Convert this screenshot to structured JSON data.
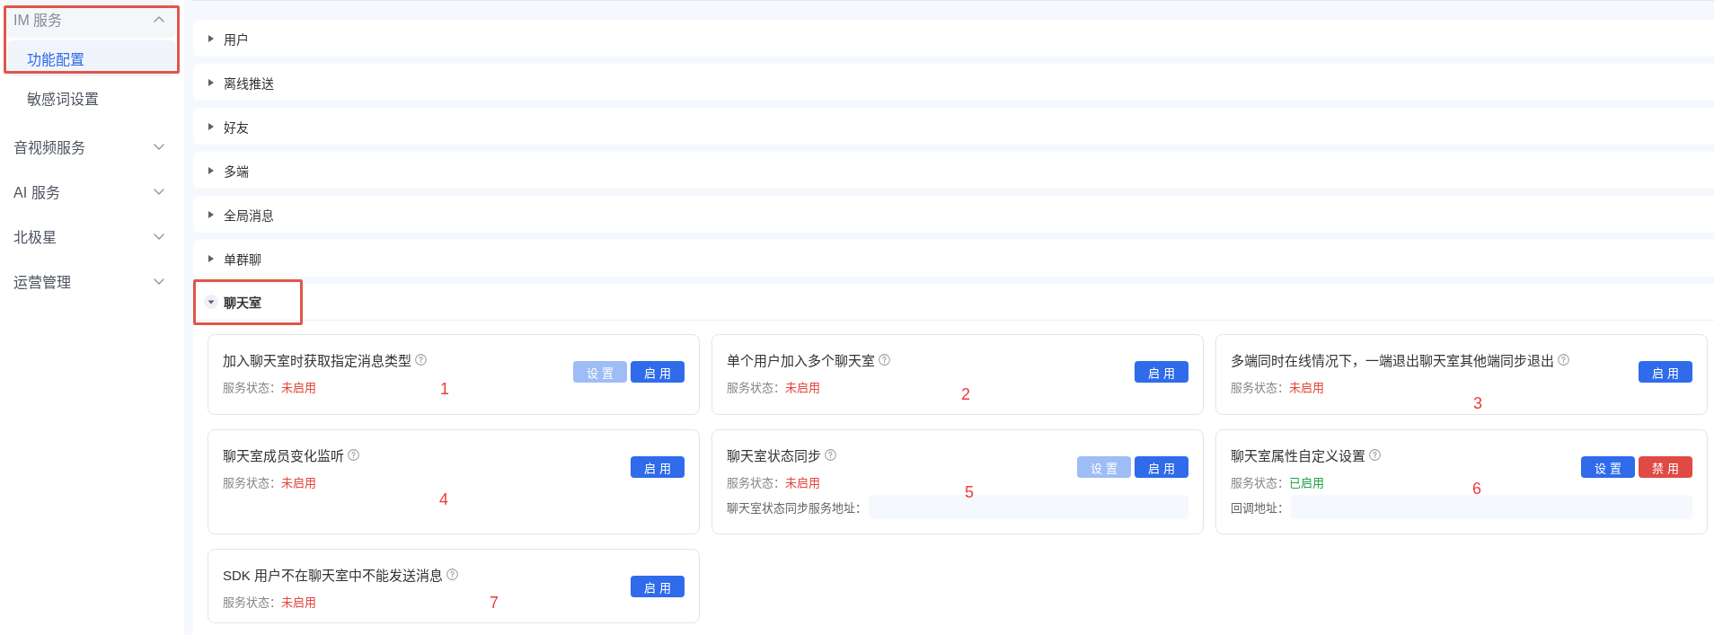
{
  "sidebar": {
    "groups": [
      {
        "label": "IM 服务",
        "expanded": true,
        "highlighted": true,
        "children": [
          {
            "label": "功能配置",
            "selected": true,
            "highlighted": true
          },
          {
            "label": "敏感词设置",
            "selected": false,
            "highlighted": false
          }
        ]
      },
      {
        "label": "音视频服务",
        "expanded": false,
        "highlighted": false
      },
      {
        "label": "AI 服务",
        "expanded": false,
        "highlighted": false
      },
      {
        "label": "北极星",
        "expanded": false,
        "highlighted": false
      },
      {
        "label": "运营管理",
        "expanded": false,
        "highlighted": false
      }
    ]
  },
  "sections": [
    {
      "label": "用户",
      "expanded": false,
      "highlighted": false
    },
    {
      "label": "离线推送",
      "expanded": false,
      "highlighted": false
    },
    {
      "label": "好友",
      "expanded": false,
      "highlighted": false
    },
    {
      "label": "多端",
      "expanded": false,
      "highlighted": false
    },
    {
      "label": "全局消息",
      "expanded": false,
      "highlighted": false
    },
    {
      "label": "单群聊",
      "expanded": false,
      "highlighted": false
    },
    {
      "label": "聊天室",
      "expanded": true,
      "highlighted": true,
      "cards": [
        {
          "title": "加入聊天室时获取指定消息类型",
          "status_label": "服务状态：",
          "status": "未启用",
          "enabled": false,
          "buttons": [
            {
              "label": "设 置",
              "kind": "primary",
              "disabled": true
            },
            {
              "label": "启 用",
              "kind": "primary",
              "disabled": false
            }
          ],
          "annotation": "1"
        },
        {
          "title": "单个用户加入多个聊天室",
          "status_label": "服务状态：",
          "status": "未启用",
          "enabled": false,
          "buttons": [
            {
              "label": "启 用",
              "kind": "primary",
              "disabled": false
            }
          ],
          "annotation": "2"
        },
        {
          "title": "多端同时在线情况下，一端退出聊天室其他端同步退出",
          "status_label": "服务状态：",
          "status": "未启用",
          "enabled": false,
          "buttons": [
            {
              "label": "启 用",
              "kind": "primary",
              "disabled": false
            }
          ],
          "annotation": "3"
        },
        {
          "title": "聊天室成员变化监听",
          "status_label": "服务状态：",
          "status": "未启用",
          "enabled": false,
          "buttons": [
            {
              "label": "启 用",
              "kind": "primary",
              "disabled": false
            }
          ],
          "annotation": "4"
        },
        {
          "title": "聊天室状态同步",
          "status_label": "服务状态：",
          "status": "未启用",
          "enabled": false,
          "buttons": [
            {
              "label": "设 置",
              "kind": "primary",
              "disabled": true
            },
            {
              "label": "启 用",
              "kind": "primary",
              "disabled": false
            }
          ],
          "field": {
            "label": "聊天室状态同步服务地址："
          },
          "annotation": "5"
        },
        {
          "title": "聊天室属性自定义设置",
          "status_label": "服务状态：",
          "status": "已启用",
          "enabled": true,
          "buttons": [
            {
              "label": "设 置",
              "kind": "primary",
              "disabled": false
            },
            {
              "label": "禁 用",
              "kind": "danger",
              "disabled": false
            }
          ],
          "field": {
            "label": "回调地址："
          },
          "annotation": "6"
        },
        {
          "title": "SDK 用户不在聊天室中不能发送消息",
          "status_label": "服务状态：",
          "status": "未启用",
          "enabled": false,
          "buttons": [
            {
              "label": "启 用",
              "kind": "primary",
              "disabled": false
            }
          ],
          "annotation": "7"
        }
      ]
    }
  ]
}
